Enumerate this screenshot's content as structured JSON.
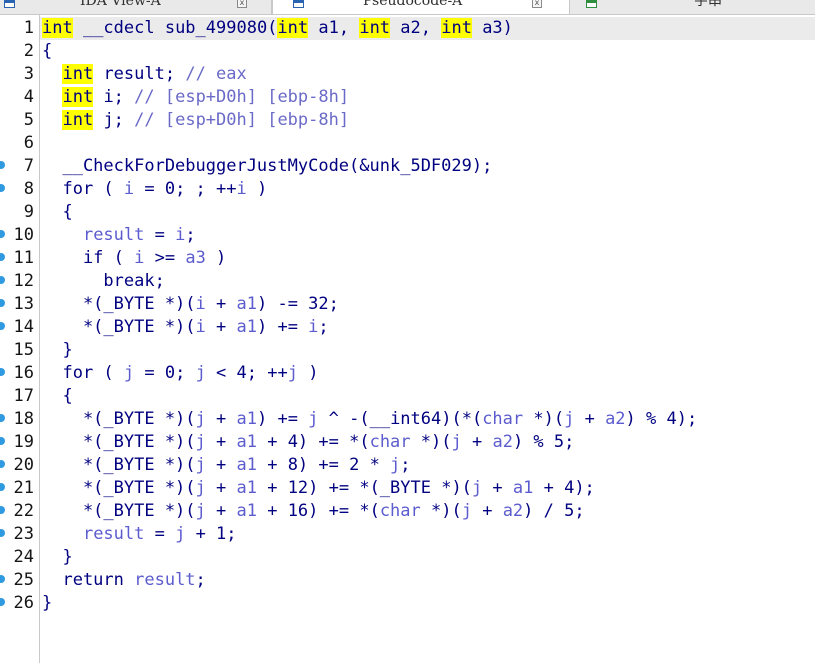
{
  "tabs": [
    {
      "label": "IDA View-A",
      "icon": "disassembly-view-icon",
      "close": "x"
    },
    {
      "label": "Pseudocode-A",
      "icon": "pseudocode-view-icon",
      "close": "x"
    },
    {
      "label": "字串",
      "icon": "strings-view-icon"
    }
  ],
  "colors": {
    "plain": "#000080",
    "variable": "#5c5ccf",
    "comment": "#6a6ac8",
    "keyword_highlight": "#ffff00",
    "breakpoint_dot": "#2f9ae0"
  },
  "code": {
    "lines": [
      {
        "num": "1",
        "dot": false,
        "tokens": [
          {
            "t": "kw",
            "v": "int"
          },
          {
            "t": "plain",
            "v": " __cdecl sub_499080("
          },
          {
            "t": "kw",
            "v": "int"
          },
          {
            "t": "plain",
            "v": " a1, "
          },
          {
            "t": "kw",
            "v": "int"
          },
          {
            "t": "plain",
            "v": " a2, "
          },
          {
            "t": "kw",
            "v": "int"
          },
          {
            "t": "plain",
            "v": " a3)"
          }
        ]
      },
      {
        "num": "2",
        "dot": false,
        "tokens": [
          {
            "t": "plain",
            "v": "{"
          }
        ]
      },
      {
        "num": "3",
        "dot": false,
        "tokens": [
          {
            "t": "plain",
            "v": "  "
          },
          {
            "t": "kw",
            "v": "int"
          },
          {
            "t": "plain",
            "v": " result; "
          },
          {
            "t": "cmt",
            "v": "// eax"
          }
        ]
      },
      {
        "num": "4",
        "dot": false,
        "tokens": [
          {
            "t": "plain",
            "v": "  "
          },
          {
            "t": "kw",
            "v": "int"
          },
          {
            "t": "plain",
            "v": " i; "
          },
          {
            "t": "cmt",
            "v": "// [esp+D0h] [ebp-8h]"
          }
        ]
      },
      {
        "num": "5",
        "dot": false,
        "tokens": [
          {
            "t": "plain",
            "v": "  "
          },
          {
            "t": "kw",
            "v": "int"
          },
          {
            "t": "plain",
            "v": " j; "
          },
          {
            "t": "cmt",
            "v": "// [esp+D0h] [ebp-8h]"
          }
        ]
      },
      {
        "num": "6",
        "dot": false,
        "tokens": []
      },
      {
        "num": "7",
        "dot": true,
        "tokens": [
          {
            "t": "plain",
            "v": "  __CheckForDebuggerJustMyCode(&unk_5DF029);"
          }
        ]
      },
      {
        "num": "8",
        "dot": true,
        "tokens": [
          {
            "t": "plain",
            "v": "  for ( "
          },
          {
            "t": "var",
            "v": "i"
          },
          {
            "t": "plain",
            "v": " = 0; ; ++"
          },
          {
            "t": "var",
            "v": "i"
          },
          {
            "t": "plain",
            "v": " )"
          }
        ]
      },
      {
        "num": "9",
        "dot": false,
        "tokens": [
          {
            "t": "plain",
            "v": "  {"
          }
        ]
      },
      {
        "num": "10",
        "dot": true,
        "tokens": [
          {
            "t": "plain",
            "v": "    "
          },
          {
            "t": "var",
            "v": "result"
          },
          {
            "t": "plain",
            "v": " = "
          },
          {
            "t": "var",
            "v": "i"
          },
          {
            "t": "plain",
            "v": ";"
          }
        ]
      },
      {
        "num": "11",
        "dot": true,
        "tokens": [
          {
            "t": "plain",
            "v": "    if ( "
          },
          {
            "t": "var",
            "v": "i"
          },
          {
            "t": "plain",
            "v": " >= "
          },
          {
            "t": "var",
            "v": "a3"
          },
          {
            "t": "plain",
            "v": " )"
          }
        ]
      },
      {
        "num": "12",
        "dot": true,
        "tokens": [
          {
            "t": "plain",
            "v": "      break;"
          }
        ]
      },
      {
        "num": "13",
        "dot": true,
        "tokens": [
          {
            "t": "plain",
            "v": "    *(_BYTE *)("
          },
          {
            "t": "var",
            "v": "i"
          },
          {
            "t": "plain",
            "v": " + "
          },
          {
            "t": "var",
            "v": "a1"
          },
          {
            "t": "plain",
            "v": ") -= 32;"
          }
        ]
      },
      {
        "num": "14",
        "dot": true,
        "tokens": [
          {
            "t": "plain",
            "v": "    *(_BYTE *)("
          },
          {
            "t": "var",
            "v": "i"
          },
          {
            "t": "plain",
            "v": " + "
          },
          {
            "t": "var",
            "v": "a1"
          },
          {
            "t": "plain",
            "v": ") += "
          },
          {
            "t": "var",
            "v": "i"
          },
          {
            "t": "plain",
            "v": ";"
          }
        ]
      },
      {
        "num": "15",
        "dot": false,
        "tokens": [
          {
            "t": "plain",
            "v": "  }"
          }
        ]
      },
      {
        "num": "16",
        "dot": true,
        "tokens": [
          {
            "t": "plain",
            "v": "  for ( "
          },
          {
            "t": "var",
            "v": "j"
          },
          {
            "t": "plain",
            "v": " = 0; "
          },
          {
            "t": "var",
            "v": "j"
          },
          {
            "t": "plain",
            "v": " < 4; ++"
          },
          {
            "t": "var",
            "v": "j"
          },
          {
            "t": "plain",
            "v": " )"
          }
        ]
      },
      {
        "num": "17",
        "dot": false,
        "tokens": [
          {
            "t": "plain",
            "v": "  {"
          }
        ]
      },
      {
        "num": "18",
        "dot": true,
        "tokens": [
          {
            "t": "plain",
            "v": "    *(_BYTE *)("
          },
          {
            "t": "var",
            "v": "j"
          },
          {
            "t": "plain",
            "v": " + "
          },
          {
            "t": "var",
            "v": "a1"
          },
          {
            "t": "plain",
            "v": ") += "
          },
          {
            "t": "var",
            "v": "j"
          },
          {
            "t": "plain",
            "v": " ^ -(__int64)(*("
          },
          {
            "t": "var",
            "v": "char"
          },
          {
            "t": "plain",
            "v": " *)("
          },
          {
            "t": "var",
            "v": "j"
          },
          {
            "t": "plain",
            "v": " + "
          },
          {
            "t": "var",
            "v": "a2"
          },
          {
            "t": "plain",
            "v": ") % 4);"
          }
        ]
      },
      {
        "num": "19",
        "dot": true,
        "tokens": [
          {
            "t": "plain",
            "v": "    *(_BYTE *)("
          },
          {
            "t": "var",
            "v": "j"
          },
          {
            "t": "plain",
            "v": " + "
          },
          {
            "t": "var",
            "v": "a1"
          },
          {
            "t": "plain",
            "v": " + 4) += *("
          },
          {
            "t": "var",
            "v": "char"
          },
          {
            "t": "plain",
            "v": " *)("
          },
          {
            "t": "var",
            "v": "j"
          },
          {
            "t": "plain",
            "v": " + "
          },
          {
            "t": "var",
            "v": "a2"
          },
          {
            "t": "plain",
            "v": ") % 5;"
          }
        ]
      },
      {
        "num": "20",
        "dot": true,
        "tokens": [
          {
            "t": "plain",
            "v": "    *(_BYTE *)("
          },
          {
            "t": "var",
            "v": "j"
          },
          {
            "t": "plain",
            "v": " + "
          },
          {
            "t": "var",
            "v": "a1"
          },
          {
            "t": "plain",
            "v": " + 8) += 2 * "
          },
          {
            "t": "var",
            "v": "j"
          },
          {
            "t": "plain",
            "v": ";"
          }
        ]
      },
      {
        "num": "21",
        "dot": true,
        "tokens": [
          {
            "t": "plain",
            "v": "    *(_BYTE *)("
          },
          {
            "t": "var",
            "v": "j"
          },
          {
            "t": "plain",
            "v": " + "
          },
          {
            "t": "var",
            "v": "a1"
          },
          {
            "t": "plain",
            "v": " + 12) += *(_BYTE *)("
          },
          {
            "t": "var",
            "v": "j"
          },
          {
            "t": "plain",
            "v": " + "
          },
          {
            "t": "var",
            "v": "a1"
          },
          {
            "t": "plain",
            "v": " + 4);"
          }
        ]
      },
      {
        "num": "22",
        "dot": true,
        "tokens": [
          {
            "t": "plain",
            "v": "    *(_BYTE *)("
          },
          {
            "t": "var",
            "v": "j"
          },
          {
            "t": "plain",
            "v": " + "
          },
          {
            "t": "var",
            "v": "a1"
          },
          {
            "t": "plain",
            "v": " + 16) += *("
          },
          {
            "t": "var",
            "v": "char"
          },
          {
            "t": "plain",
            "v": " *)("
          },
          {
            "t": "var",
            "v": "j"
          },
          {
            "t": "plain",
            "v": " + "
          },
          {
            "t": "var",
            "v": "a2"
          },
          {
            "t": "plain",
            "v": ") / 5;"
          }
        ]
      },
      {
        "num": "23",
        "dot": true,
        "tokens": [
          {
            "t": "plain",
            "v": "    "
          },
          {
            "t": "var",
            "v": "result"
          },
          {
            "t": "plain",
            "v": " = "
          },
          {
            "t": "var",
            "v": "j"
          },
          {
            "t": "plain",
            "v": " + 1;"
          }
        ]
      },
      {
        "num": "24",
        "dot": false,
        "tokens": [
          {
            "t": "plain",
            "v": "  }"
          }
        ]
      },
      {
        "num": "25",
        "dot": true,
        "tokens": [
          {
            "t": "plain",
            "v": "  return "
          },
          {
            "t": "var",
            "v": "result"
          },
          {
            "t": "plain",
            "v": ";"
          }
        ]
      },
      {
        "num": "26",
        "dot": true,
        "tokens": [
          {
            "t": "plain",
            "v": "}"
          }
        ]
      }
    ]
  }
}
